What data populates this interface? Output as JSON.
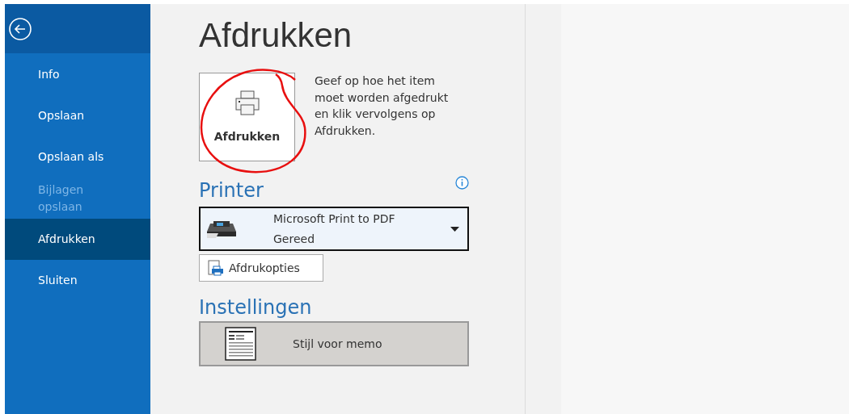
{
  "sidebar": {
    "items": [
      {
        "label": "Info",
        "selected": false,
        "disabled": false
      },
      {
        "label": "Opslaan",
        "selected": false,
        "disabled": false
      },
      {
        "label": "Opslaan als",
        "selected": false,
        "disabled": false
      },
      {
        "label": "Bijlagen opslaan",
        "selected": false,
        "disabled": true
      },
      {
        "label": "Afdrukken",
        "selected": true,
        "disabled": false
      },
      {
        "label": "Sluiten",
        "selected": false,
        "disabled": false
      }
    ]
  },
  "title": "Afdrukken",
  "print_button": {
    "label": "Afdrukken"
  },
  "description": "Geef op hoe het item moet worden afgedrukt en klik vervolgens op Afdrukken.",
  "printer": {
    "heading": "Printer",
    "name": "Microsoft Print to PDF",
    "status": "Gereed"
  },
  "printer_options_button": {
    "label": "Afdrukopties"
  },
  "settings": {
    "heading": "Instellingen",
    "style": "Stijl voor memo"
  }
}
